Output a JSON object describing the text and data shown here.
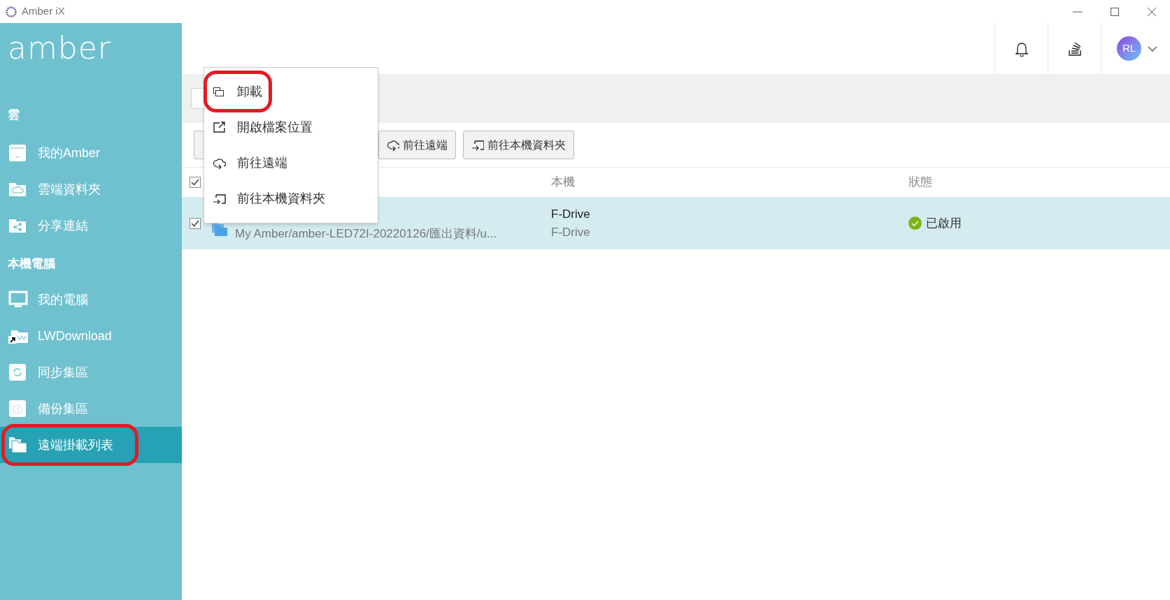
{
  "window": {
    "title": "Amber iX"
  },
  "sidebar": {
    "logo": "amber",
    "sections": [
      {
        "heading": "雲",
        "items": [
          {
            "label": "我的Amber",
            "kind": "nas",
            "selected": false,
            "highlighted": false
          },
          {
            "label": "雲端資料夾",
            "kind": "cloud-folder",
            "selected": false,
            "highlighted": false
          },
          {
            "label": "分享連結",
            "kind": "share-folder",
            "selected": false,
            "highlighted": false
          }
        ]
      },
      {
        "heading": "本機電腦",
        "items": [
          {
            "label": "我的電腦",
            "kind": "monitor",
            "selected": false,
            "highlighted": false
          },
          {
            "label": "LWDownload",
            "kind": "shortcut",
            "selected": false,
            "highlighted": false
          },
          {
            "label": "同步集區",
            "kind": "sync",
            "selected": false,
            "highlighted": false
          },
          {
            "label": "備份集區",
            "kind": "backup",
            "selected": false,
            "highlighted": false
          },
          {
            "label": "遠端掛載列表",
            "kind": "mounts",
            "selected": true,
            "highlighted": true
          }
        ]
      }
    ]
  },
  "header": {
    "avatar": "RL"
  },
  "toolbar": {
    "buttons": [
      {
        "label": "前往遠端",
        "kind": "remote"
      },
      {
        "label": "前往本機資料夾",
        "kind": "local"
      }
    ]
  },
  "table": {
    "columns": [
      "本機",
      "狀態"
    ],
    "all_checked": true,
    "rows": [
      {
        "checked": true,
        "selected": true,
        "path": "My Amber/amber-LED72I-20220126/匯出資料/u...",
        "local": "F-Drive",
        "local_2": "F-Drive",
        "status": "已啟用"
      }
    ]
  },
  "context_menu": {
    "items": [
      {
        "label": "卸載",
        "kind": "unmount",
        "highlighted": true
      },
      {
        "label": "開啟檔案位置",
        "kind": "open",
        "highlighted": false
      },
      {
        "label": "前往遠端",
        "kind": "remote",
        "highlighted": false
      },
      {
        "label": "前往本機資料夾",
        "kind": "local",
        "highlighted": false
      }
    ]
  }
}
